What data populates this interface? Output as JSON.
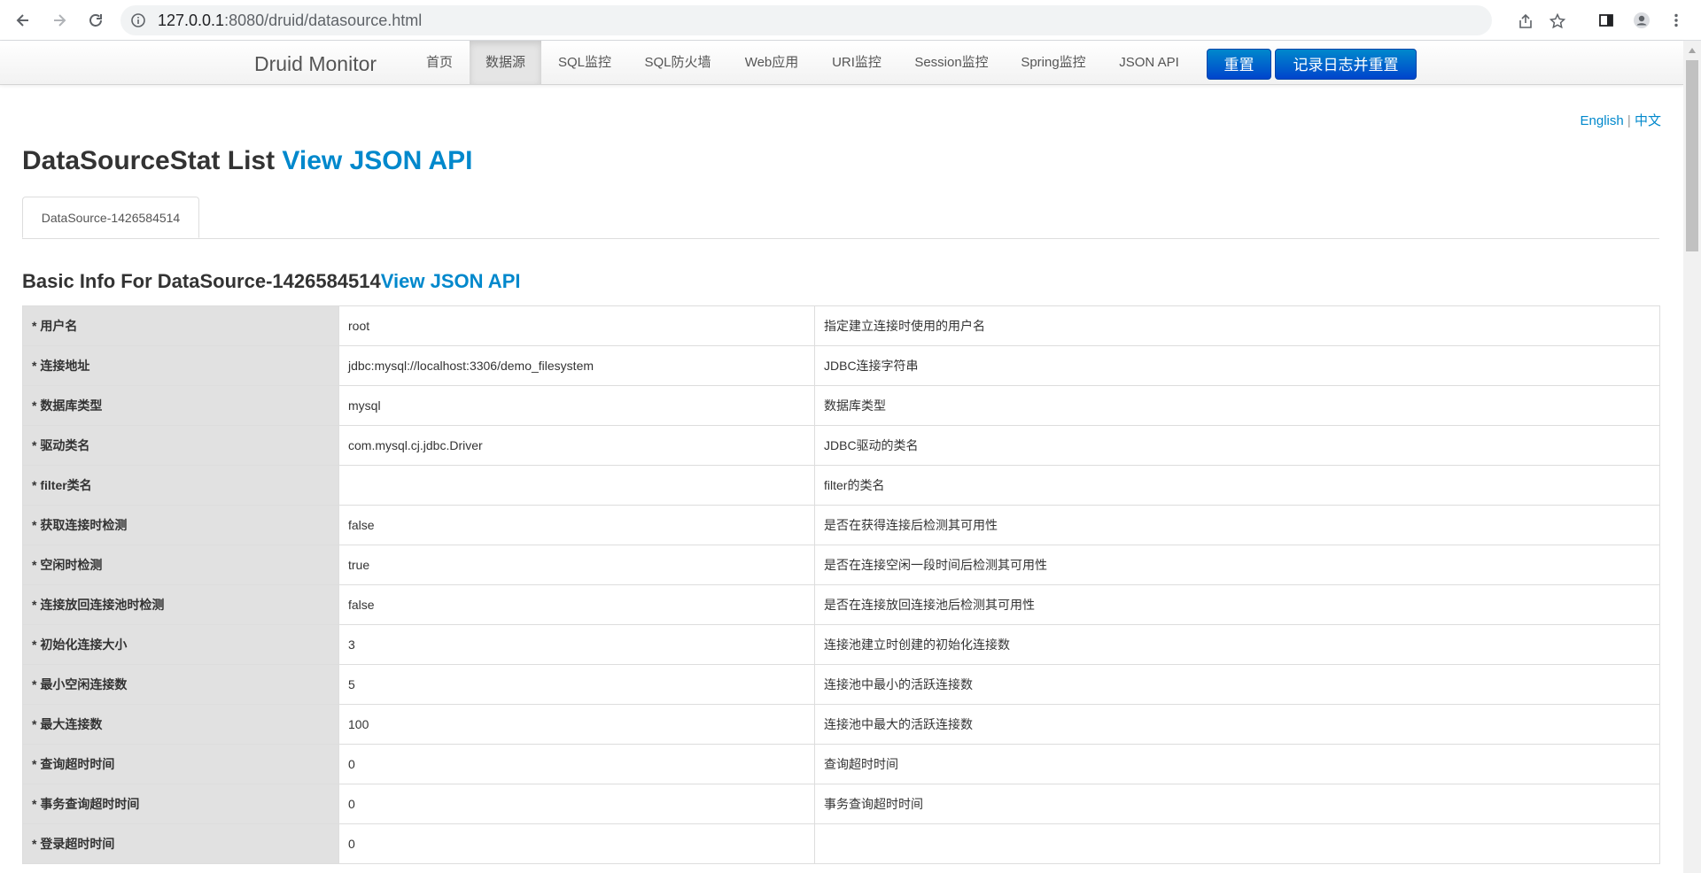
{
  "browser": {
    "url_host": "127.0.0.1",
    "url_rest": ":8080/druid/datasource.html",
    "icons": [
      "back-icon",
      "forward-icon",
      "reload-icon",
      "site-info-icon",
      "share-icon",
      "bookmark-star-icon",
      "sidebar-icon",
      "profile-icon",
      "menu-kebab-icon"
    ]
  },
  "nav": {
    "brand": "Druid Monitor",
    "items": [
      {
        "label": "首页",
        "active": false
      },
      {
        "label": "数据源",
        "active": true
      },
      {
        "label": "SQL监控",
        "active": false
      },
      {
        "label": "SQL防火墙",
        "active": false
      },
      {
        "label": "Web应用",
        "active": false
      },
      {
        "label": "URI监控",
        "active": false
      },
      {
        "label": "Session监控",
        "active": false
      },
      {
        "label": "Spring监控",
        "active": false
      },
      {
        "label": "JSON API",
        "active": false
      }
    ],
    "reset_label": "重置",
    "log_reset_label": "记录日志并重置",
    "button_color": "#0066cc"
  },
  "lang": {
    "english": "English",
    "separator": "|",
    "chinese": "中文"
  },
  "title": {
    "main": "DataSourceStat List ",
    "json_link": "View JSON API"
  },
  "tab": {
    "label": "DataSource-1426584514"
  },
  "section": {
    "title": "Basic Info For DataSource-1426584514",
    "json_link": "View JSON API"
  },
  "rows": [
    {
      "key": "* 用户名",
      "value": "root",
      "desc": "指定建立连接时使用的用户名"
    },
    {
      "key": "* 连接地址",
      "value": "jdbc:mysql://localhost:3306/demo_filesystem",
      "desc": "JDBC连接字符串"
    },
    {
      "key": "* 数据库类型",
      "value": "mysql",
      "desc": "数据库类型"
    },
    {
      "key": "* 驱动类名",
      "value": "com.mysql.cj.jdbc.Driver",
      "desc": "JDBC驱动的类名"
    },
    {
      "key": "* filter类名",
      "value": "",
      "desc": "filter的类名"
    },
    {
      "key": "* 获取连接时检测",
      "value": "false",
      "desc": "是否在获得连接后检测其可用性"
    },
    {
      "key": "* 空闲时检测",
      "value": "true",
      "desc": "是否在连接空闲一段时间后检测其可用性"
    },
    {
      "key": "* 连接放回连接池时检测",
      "value": "false",
      "desc": "是否在连接放回连接池后检测其可用性"
    },
    {
      "key": "* 初始化连接大小",
      "value": "3",
      "desc": "连接池建立时创建的初始化连接数"
    },
    {
      "key": "* 最小空闲连接数",
      "value": "5",
      "desc": "连接池中最小的活跃连接数"
    },
    {
      "key": "* 最大连接数",
      "value": "100",
      "desc": "连接池中最大的活跃连接数"
    },
    {
      "key": "* 查询超时时间",
      "value": "0",
      "desc": "查询超时时间"
    },
    {
      "key": "* 事务查询超时时间",
      "value": "0",
      "desc": "事务查询超时时间"
    },
    {
      "key": "* 登录超时时间",
      "value": "0",
      "desc": ""
    }
  ]
}
